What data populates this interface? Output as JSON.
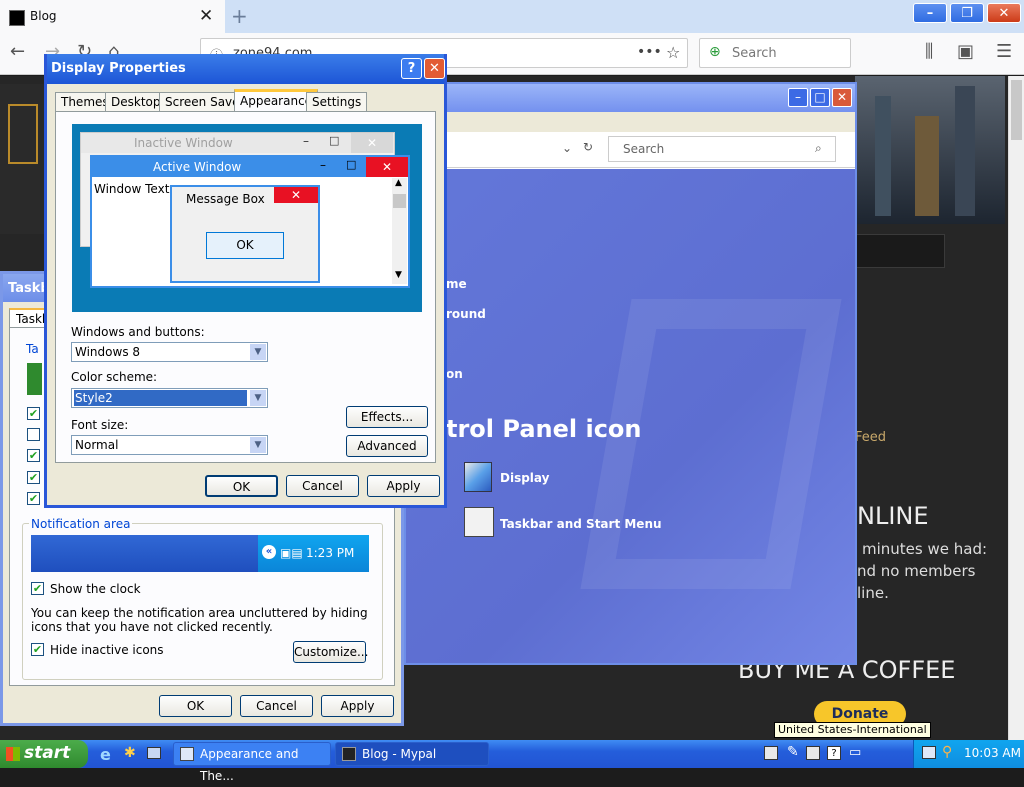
{
  "browser": {
    "tab_title": "Blog",
    "url": "zone94.com",
    "search_placeholder": "Search",
    "new_tab_label": "+"
  },
  "control_panel": {
    "search_placeholder": "Search",
    "side_links": [
      "me",
      "round",
      "on"
    ],
    "heading": "trol Panel icon",
    "items": [
      {
        "label": "Display"
      },
      {
        "label": "Taskbar and Start Menu"
      }
    ]
  },
  "website": {
    "feed_text": "Feed",
    "online_heading": "NLINE",
    "online_line1": "minutes we had:",
    "online_line2": "nd no members",
    "online_line3": "line.",
    "coffee_heading": "BUY ME A COFFEE",
    "donate_label": "Donate"
  },
  "taskbar_props": {
    "title": "Taskba",
    "tab": "Taskb",
    "group_label_partial": "Ta",
    "notification_area": "Notification area",
    "tray_time": "1:23 PM",
    "show_clock": "Show the clock",
    "show_clock_checked": true,
    "description": "You can keep the notification area uncluttered by hiding icons that you have not clicked recently.",
    "hide_inactive": "Hide inactive icons",
    "hide_inactive_checked": true,
    "customize": "Customize...",
    "ok": "OK",
    "cancel": "Cancel",
    "apply": "Apply"
  },
  "display_props": {
    "title": "Display Properties",
    "tabs": [
      "Themes",
      "Desktop",
      "Screen Saver",
      "Appearance",
      "Settings"
    ],
    "active_tab": "Appearance",
    "preview": {
      "inactive_window": "Inactive Window",
      "active_window": "Active Window",
      "window_text": "Window Text",
      "message_box": "Message Box",
      "ok": "OK"
    },
    "windows_buttons_label": "Windows and buttons:",
    "windows_buttons_value": "Windows 8",
    "color_scheme_label": "Color scheme:",
    "color_scheme_value": "Style2",
    "font_size_label": "Font size:",
    "font_size_value": "Normal",
    "effects": "Effects...",
    "advanced": "Advanced",
    "ok": "OK",
    "cancel": "Cancel",
    "apply": "Apply"
  },
  "xp_taskbar": {
    "start": "start",
    "tasks": [
      {
        "label": "Appearance and The..."
      },
      {
        "label": "Blog - Mypal"
      }
    ],
    "language_tooltip": "United States-International",
    "clock": "10:03 AM"
  }
}
